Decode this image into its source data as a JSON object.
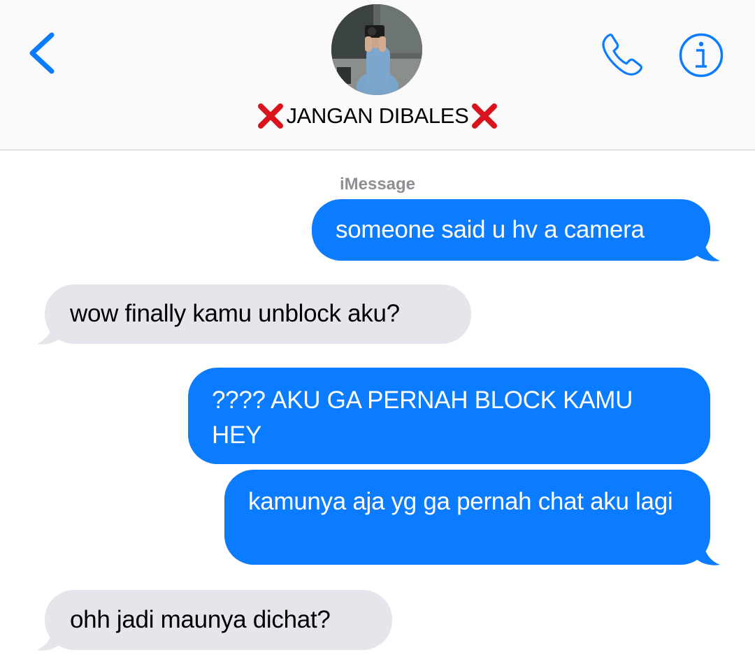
{
  "header": {
    "contact_name": "JANGAN DIBALES",
    "name_prefix_emoji": "cross-mark-icon",
    "name_suffix_emoji": "cross-mark-icon",
    "back_icon": "chevron-left-icon",
    "call_icon": "phone-icon",
    "info_icon": "info-icon",
    "accent_color": "#0b7bff"
  },
  "conversation": {
    "service_label": "iMessage",
    "messages": [
      {
        "direction": "sent",
        "text": "someone said u hv a camera"
      },
      {
        "direction": "received",
        "text": "wow finally kamu unblock aku?"
      },
      {
        "direction": "sent",
        "text": "???? AKU GA PERNAH BLOCK KAMU HEY"
      },
      {
        "direction": "sent",
        "text": "kamunya aja yg ga pernah chat aku lagi"
      },
      {
        "direction": "received",
        "text": "ohh jadi maunya dichat?"
      }
    ],
    "sent_bubble_color": "#0b7bff",
    "received_bubble_color": "#e6e5eb"
  }
}
